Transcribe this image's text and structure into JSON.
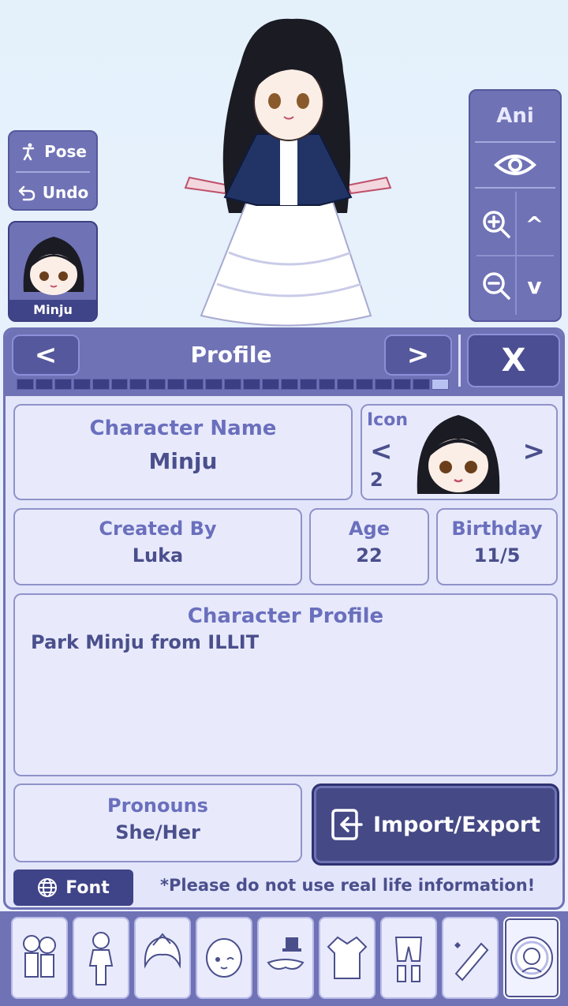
{
  "controls": {
    "pose_label": "Pose",
    "undo_label": "Undo",
    "character_name": "Minju",
    "ani_label": "Ani",
    "zoom_up": "^",
    "zoom_down": "v"
  },
  "panel": {
    "title": "Profile",
    "prev_label": "<",
    "next_label": ">",
    "close_label": "X",
    "progress": {
      "current": 23,
      "total": 23
    }
  },
  "profile": {
    "character_name_label": "Character Name",
    "character_name": "Minju",
    "icon_label": "Icon",
    "icon_number": "2",
    "icon_prev": "<",
    "icon_next": ">",
    "created_by_label": "Created By",
    "created_by": "Luka",
    "age_label": "Age",
    "age": "22",
    "birthday_label": "Birthday",
    "birthday": "11/5",
    "character_profile_label": "Character Profile",
    "character_profile": "Park Minju from ILLIT",
    "pronouns_label": "Pronouns",
    "pronouns": "She/Her",
    "import_export_label": "Import/Export",
    "font_label": "Font",
    "notice": "*Please do not use real life information!"
  },
  "toolbar": {
    "items": [
      {
        "icon": "characters-icon"
      },
      {
        "icon": "body-icon"
      },
      {
        "icon": "hair-icon"
      },
      {
        "icon": "face-icon"
      },
      {
        "icon": "accessories-icon"
      },
      {
        "icon": "top-clothing-icon"
      },
      {
        "icon": "bottom-clothing-icon"
      },
      {
        "icon": "props-icon"
      },
      {
        "icon": "profile-icon",
        "selected": true
      }
    ]
  },
  "colors": {
    "primary": "#6f72b5",
    "dark": "#3f4387",
    "panel_bg": "#e3e5fb",
    "text": "#4a4f8c",
    "label": "#6a6fbd"
  }
}
